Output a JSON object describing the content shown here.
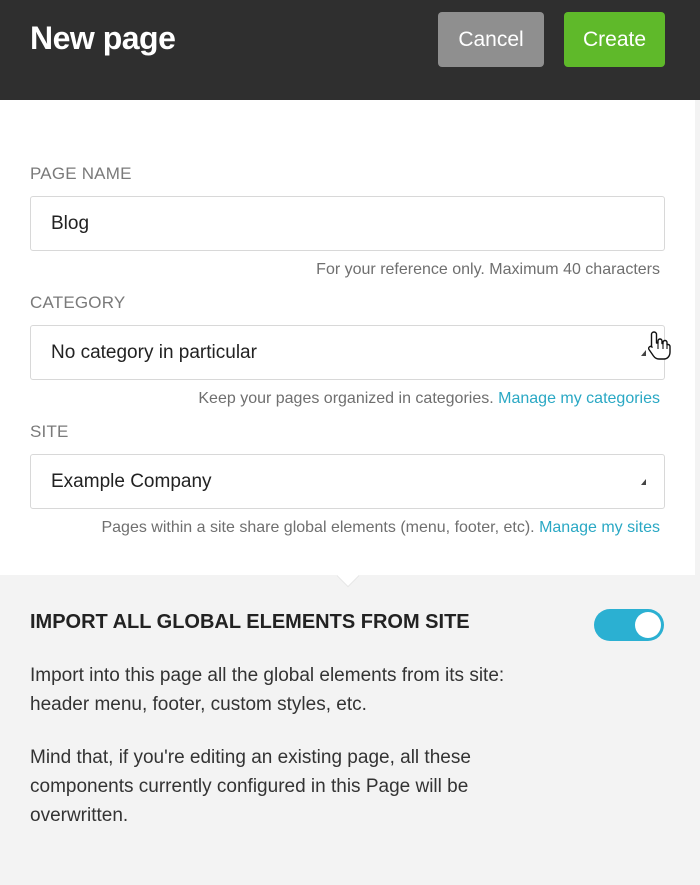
{
  "header": {
    "title": "New page",
    "cancel_label": "Cancel",
    "create_label": "Create"
  },
  "page_name": {
    "label": "PAGE NAME",
    "value": "Blog",
    "help": "For your reference only. Maximum 40 characters"
  },
  "category": {
    "label": "CATEGORY",
    "selected": "No category in particular",
    "help": "Keep your pages organized in categories.",
    "link": "Manage my categories"
  },
  "site": {
    "label": "SITE",
    "selected": "Example Company",
    "help": "Pages within a site share global elements (menu, footer, etc).",
    "link": "Manage my sites"
  },
  "import": {
    "title": "IMPORT ALL GLOBAL ELEMENTS FROM SITE",
    "toggle_on": true,
    "description": "Import into this page all the global elements from its site: header menu, footer, custom styles, etc.",
    "warning": "Mind that, if you're editing an existing page, all these components currently configured in this Page will be overwritten."
  },
  "colors": {
    "header_bg": "#2f2f2f",
    "cancel_bg": "#8f8f8f",
    "create_bg": "#5fb92a",
    "link": "#2aa8c4",
    "toggle_on": "#2bb0d2"
  },
  "icons": {
    "dropdown_caret": "caret-down-icon",
    "cursor": "hand-pointer-icon"
  }
}
